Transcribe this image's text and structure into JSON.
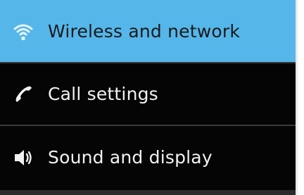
{
  "settings_menu": {
    "items": [
      {
        "label": "Wireless and network",
        "icon": "wifi-icon",
        "selected": true
      },
      {
        "label": "Call settings",
        "icon": "phone-icon",
        "selected": false
      },
      {
        "label": "Sound and display",
        "icon": "speaker-icon",
        "selected": false
      }
    ]
  },
  "colors": {
    "selected_background": "#55b6ea",
    "list_background": "#050505",
    "text": "#f2f2f2"
  }
}
